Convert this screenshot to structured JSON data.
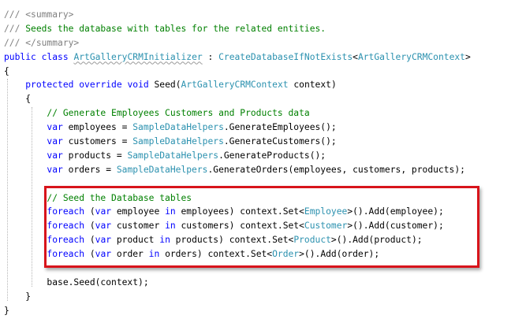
{
  "editor": {
    "lines": [
      [
        {
          "t": "/// ",
          "c": "dc"
        },
        {
          "t": "<summary>",
          "c": "dc"
        }
      ],
      [
        {
          "t": "/// ",
          "c": "dc"
        },
        {
          "t": "Seeds the database with tables for the related entities.",
          "c": "cm"
        }
      ],
      [
        {
          "t": "/// ",
          "c": "dc"
        },
        {
          "t": "</summary>",
          "c": "dc"
        }
      ],
      [
        {
          "t": "public",
          "c": "kw"
        },
        {
          "t": " ",
          "c": "pl"
        },
        {
          "t": "class",
          "c": "kw"
        },
        {
          "t": " ",
          "c": "pl"
        },
        {
          "t": "ArtGalleryCRMInitializer",
          "c": "ty",
          "squiggle": true
        },
        {
          "t": " : ",
          "c": "pl"
        },
        {
          "t": "CreateDatabaseIfNotExists",
          "c": "ty"
        },
        {
          "t": "<",
          "c": "pl"
        },
        {
          "t": "ArtGalleryCRMContext",
          "c": "ty"
        },
        {
          "t": ">",
          "c": "pl"
        }
      ],
      [
        {
          "t": "{",
          "c": "pl"
        }
      ],
      [
        {
          "t": "    ",
          "c": "pl"
        },
        {
          "t": "protected",
          "c": "kw"
        },
        {
          "t": " ",
          "c": "pl"
        },
        {
          "t": "override",
          "c": "kw"
        },
        {
          "t": " ",
          "c": "pl"
        },
        {
          "t": "void",
          "c": "kw"
        },
        {
          "t": " Seed(",
          "c": "pl"
        },
        {
          "t": "ArtGalleryCRMContext",
          "c": "ty"
        },
        {
          "t": " context)",
          "c": "pl"
        }
      ],
      [
        {
          "t": "    {",
          "c": "pl"
        }
      ],
      [
        {
          "t": "        ",
          "c": "pl"
        },
        {
          "t": "// Generate Employees Customers and Products data",
          "c": "cm"
        }
      ],
      [
        {
          "t": "        ",
          "c": "pl"
        },
        {
          "t": "var",
          "c": "kw"
        },
        {
          "t": " employees = ",
          "c": "pl"
        },
        {
          "t": "SampleDataHelpers",
          "c": "ty"
        },
        {
          "t": ".GenerateEmployees();",
          "c": "pl"
        }
      ],
      [
        {
          "t": "        ",
          "c": "pl"
        },
        {
          "t": "var",
          "c": "kw"
        },
        {
          "t": " customers = ",
          "c": "pl"
        },
        {
          "t": "SampleDataHelpers",
          "c": "ty"
        },
        {
          "t": ".GenerateCustomers();",
          "c": "pl"
        }
      ],
      [
        {
          "t": "        ",
          "c": "pl"
        },
        {
          "t": "var",
          "c": "kw"
        },
        {
          "t": " products = ",
          "c": "pl"
        },
        {
          "t": "SampleDataHelpers",
          "c": "ty"
        },
        {
          "t": ".GenerateProducts();",
          "c": "pl"
        }
      ],
      [
        {
          "t": "        ",
          "c": "pl"
        },
        {
          "t": "var",
          "c": "kw"
        },
        {
          "t": " orders = ",
          "c": "pl"
        },
        {
          "t": "SampleDataHelpers",
          "c": "ty"
        },
        {
          "t": ".GenerateOrders(employees, customers, products);",
          "c": "pl"
        }
      ],
      [
        {
          "t": "",
          "c": "pl"
        }
      ],
      [
        {
          "t": "        ",
          "c": "pl"
        },
        {
          "t": "// Seed the Database tables",
          "c": "cm"
        }
      ],
      [
        {
          "t": "        ",
          "c": "pl"
        },
        {
          "t": "foreach",
          "c": "kw"
        },
        {
          "t": " (",
          "c": "pl"
        },
        {
          "t": "var",
          "c": "kw"
        },
        {
          "t": " employee ",
          "c": "pl"
        },
        {
          "t": "in",
          "c": "kw"
        },
        {
          "t": " employees) context.Set<",
          "c": "pl"
        },
        {
          "t": "Employee",
          "c": "ty"
        },
        {
          "t": ">().Add(employee);",
          "c": "pl"
        }
      ],
      [
        {
          "t": "        ",
          "c": "pl"
        },
        {
          "t": "foreach",
          "c": "kw"
        },
        {
          "t": " (",
          "c": "pl"
        },
        {
          "t": "var",
          "c": "kw"
        },
        {
          "t": " customer ",
          "c": "pl"
        },
        {
          "t": "in",
          "c": "kw"
        },
        {
          "t": " customers) context.Set<",
          "c": "pl"
        },
        {
          "t": "Customer",
          "c": "ty"
        },
        {
          "t": ">().Add(customer);",
          "c": "pl"
        }
      ],
      [
        {
          "t": "        ",
          "c": "pl"
        },
        {
          "t": "foreach",
          "c": "kw"
        },
        {
          "t": " (",
          "c": "pl"
        },
        {
          "t": "var",
          "c": "kw"
        },
        {
          "t": " product ",
          "c": "pl"
        },
        {
          "t": "in",
          "c": "kw"
        },
        {
          "t": " products) context.Set<",
          "c": "pl"
        },
        {
          "t": "Product",
          "c": "ty"
        },
        {
          "t": ">().Add(product);",
          "c": "pl"
        }
      ],
      [
        {
          "t": "        ",
          "c": "pl"
        },
        {
          "t": "foreach",
          "c": "kw"
        },
        {
          "t": " (",
          "c": "pl"
        },
        {
          "t": "var",
          "c": "kw"
        },
        {
          "t": " order ",
          "c": "pl"
        },
        {
          "t": "in",
          "c": "kw"
        },
        {
          "t": " orders) context.Set<",
          "c": "pl"
        },
        {
          "t": "Order",
          "c": "ty"
        },
        {
          "t": ">().Add(order);",
          "c": "pl"
        }
      ],
      [
        {
          "t": "",
          "c": "pl"
        }
      ],
      [
        {
          "t": "        base.Seed(context);",
          "c": "pl"
        }
      ],
      [
        {
          "t": "    }",
          "c": "pl"
        }
      ],
      [
        {
          "t": "}",
          "c": "pl"
        }
      ]
    ]
  },
  "colors": {
    "keyword": "#0000ff",
    "type": "#2b91af",
    "comment": "#008000",
    "doc_comment": "#808080",
    "highlight_border": "#d8141b"
  }
}
